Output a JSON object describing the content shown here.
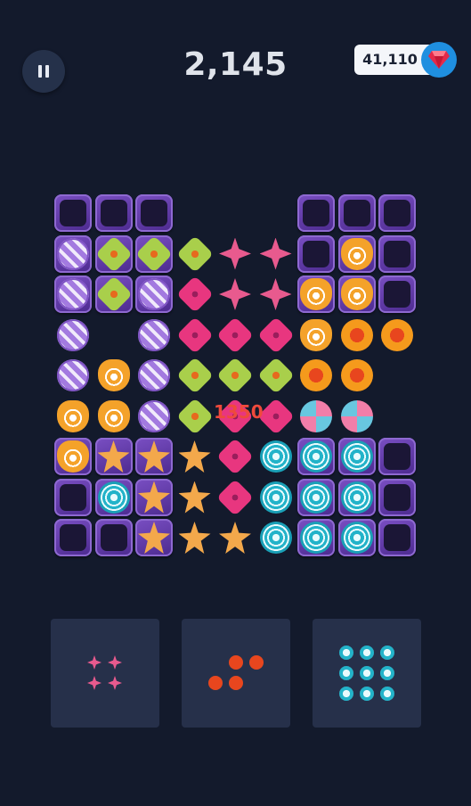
{
  "header": {
    "pause_icon": "pause-icon",
    "score": "2,145",
    "gems_count": "41,110",
    "gem_icon": "ruby-gem-icon",
    "gem_color": "#e52a4a"
  },
  "popup": {
    "points": "1350"
  },
  "board": {
    "rows": 9,
    "cols": 9,
    "cells": [
      [
        "empty",
        "empty",
        "empty",
        null,
        null,
        null,
        "empty",
        "empty",
        "empty"
      ],
      [
        "purple",
        "green",
        "green",
        "green-f",
        "pinkstar-f",
        "pinkstar-f",
        "empty",
        "orange",
        "empty"
      ],
      [
        "purple",
        "green",
        "purple",
        "pink-f",
        "pinkstar-f",
        "pinkstar-f",
        "orange",
        "orange",
        "empty"
      ],
      [
        "purple-f",
        null,
        "purple-f",
        "pink-f",
        "pink-f",
        "pink-f",
        "orange-f",
        "redorange-f",
        "redorange-f"
      ],
      [
        "purple-f",
        "orange-f",
        "purple-f",
        "green-f",
        "green-f",
        "green-f",
        "redorange-f",
        "redorange-f",
        null
      ],
      [
        "orange-f",
        "orange-f",
        "purple-f",
        "green-f",
        "pink-f",
        "pink-f",
        "swirl-f",
        "swirl-f",
        null
      ],
      [
        "orange",
        "star",
        "star",
        "star-f",
        "pink-f",
        "cyan-f",
        "cyan",
        "cyan",
        "empty"
      ],
      [
        "empty",
        "cyan",
        "star",
        "star-f",
        "pink-f",
        "cyan-f",
        "cyan",
        "cyan",
        "empty"
      ],
      [
        "empty",
        "empty",
        "star",
        "star-f",
        "star-f",
        "cyan-f",
        "cyan",
        "cyan",
        "empty"
      ]
    ]
  },
  "trays": [
    {
      "piece": "pink-plus",
      "candy": "pinkstar"
    },
    {
      "piece": "red-zigzag",
      "candy": "redorange"
    },
    {
      "piece": "cyan-3x3",
      "candy": "cyan"
    }
  ]
}
